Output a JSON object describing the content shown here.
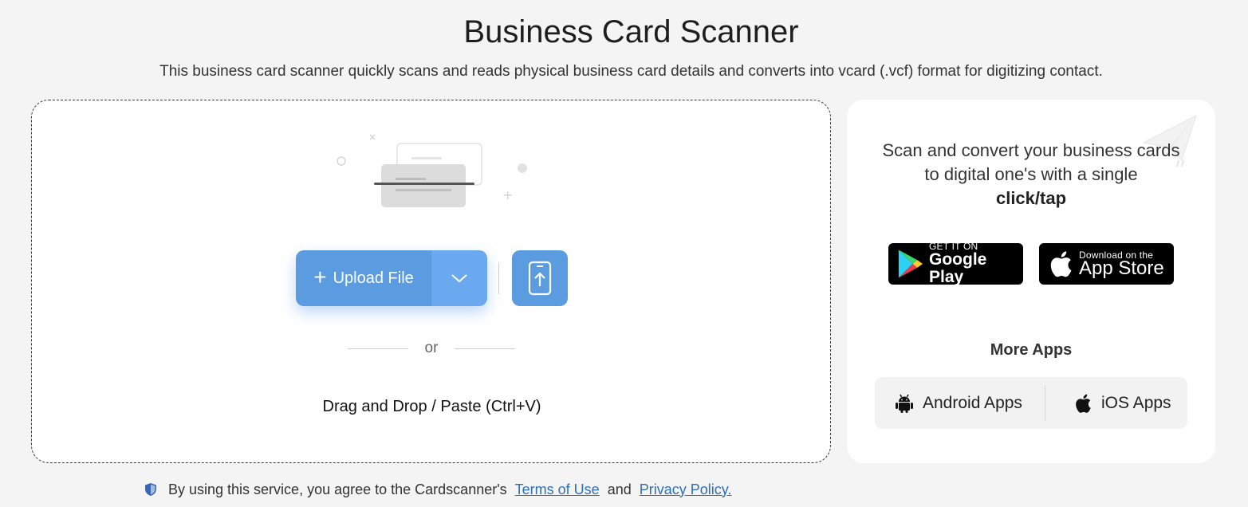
{
  "header": {
    "title": "Business Card Scanner",
    "subtitle": "This business card scanner quickly scans and reads physical business card details and converts into vcard (.vcf) format for digitizing contact."
  },
  "upload": {
    "upload_label": "Upload File",
    "or_label": "or",
    "drag_text": "Drag and Drop / Paste (Ctrl+V)"
  },
  "side": {
    "promo_text": "Scan and convert your business cards to digital one's with a single",
    "promo_bold": "click/tap",
    "google_small": "GET IT ON",
    "google_big": "Google Play",
    "apple_small": "Download on the",
    "apple_big": "App Store",
    "more_title": "More Apps",
    "android_label": "Android Apps",
    "ios_label": "iOS Apps"
  },
  "footer": {
    "text": "By using this service, you agree to the Cardscanner's",
    "terms": "Terms of Use",
    "and": "and",
    "privacy": "Privacy Policy."
  },
  "colors": {
    "accent": "#5b9be0",
    "accent_light": "#6aa9f0",
    "link": "#2e6fb5",
    "background": "#f4f4f4"
  },
  "icons": [
    "plus-icon",
    "chevron-down-icon",
    "mobile-upload-icon",
    "paper-plane-icon",
    "google-play-icon",
    "apple-icon",
    "android-icon",
    "shield-icon"
  ]
}
